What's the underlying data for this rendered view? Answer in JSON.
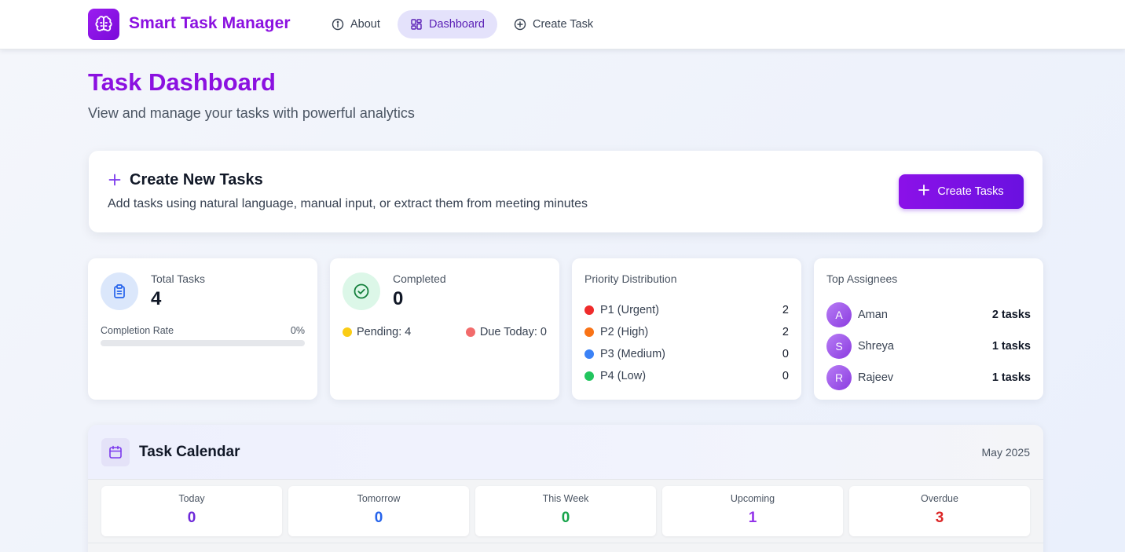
{
  "nav": {
    "brand": "Smart Task Manager",
    "items": [
      {
        "label": "About",
        "icon": "info-icon"
      },
      {
        "label": "Dashboard",
        "icon": "grid-icon",
        "active": true
      },
      {
        "label": "Create Task",
        "icon": "plus-circle-icon"
      }
    ]
  },
  "header": {
    "title": "Task Dashboard",
    "subtitle": "View and manage your tasks with powerful analytics"
  },
  "create_card": {
    "title": "Create New Tasks",
    "description": "Add tasks using natural language, manual input, or extract them from meeting minutes",
    "button_label": "Create Tasks"
  },
  "stats": {
    "total": {
      "label": "Total Tasks",
      "value": "4",
      "completion_label": "Completion Rate",
      "completion_value": "0%",
      "completion_fraction": 0
    },
    "completed": {
      "label": "Completed",
      "value": "0",
      "pending": "Pending: 4",
      "due_today": "Due Today: 0"
    },
    "priority": {
      "title": "Priority Distribution",
      "rows": [
        {
          "label": "P1 (Urgent)",
          "count": "2",
          "color": "#ef2b2b"
        },
        {
          "label": "P2 (High)",
          "count": "2",
          "color": "#f97316"
        },
        {
          "label": "P3 (Medium)",
          "count": "0",
          "color": "#3b82f6"
        },
        {
          "label": "P4 (Low)",
          "count": "0",
          "color": "#22c55e"
        }
      ]
    },
    "assignees": {
      "title": "Top Assignees",
      "rows": [
        {
          "initial": "A",
          "name": "Aman",
          "count": "2 tasks"
        },
        {
          "initial": "S",
          "name": "Shreya",
          "count": "1 tasks"
        },
        {
          "initial": "R",
          "name": "Rajeev",
          "count": "1 tasks"
        }
      ]
    }
  },
  "calendar": {
    "title": "Task Calendar",
    "month": "May 2025",
    "tiles": [
      {
        "label": "Today",
        "value": "0",
        "color": "#6d28d9"
      },
      {
        "label": "Tomorrow",
        "value": "0",
        "color": "#2563eb"
      },
      {
        "label": "This Week",
        "value": "0",
        "color": "#16a34a"
      },
      {
        "label": "Upcoming",
        "value": "1",
        "color": "#9333ea"
      },
      {
        "label": "Overdue",
        "value": "3",
        "color": "#dc2626"
      }
    ]
  },
  "colors": {
    "brand": "#8b11e0",
    "pending_dot": "#facc15",
    "due_dot": "#f26b6b"
  }
}
